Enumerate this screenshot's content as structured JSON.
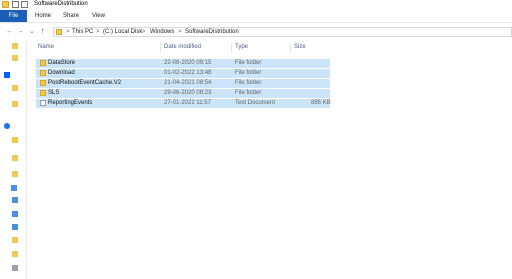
{
  "window": {
    "title": "SoftwareDistribution"
  },
  "ribbon": {
    "file_label": "File",
    "tabs": [
      "Home",
      "Share",
      "View"
    ]
  },
  "address": {
    "crumbs": [
      "This PC",
      "(C:) Local Disk",
      "Windows",
      "SoftwareDistribution"
    ],
    "separator": ">"
  },
  "nav": {
    "back": "←",
    "forward": "→",
    "recent": "⌄",
    "up": "↑"
  },
  "columns": {
    "name": "Name",
    "date": "Date modified",
    "type": "Type",
    "size": "Size"
  },
  "files": [
    {
      "name": "DataStore",
      "date": "22-06-2020 09:15",
      "type": "File folder",
      "size": "",
      "icon": "folder-icon"
    },
    {
      "name": "Download",
      "date": "01-02-2022 13:48",
      "type": "File folder",
      "size": "",
      "icon": "folder-icon"
    },
    {
      "name": "PostRebootEventCache.V2",
      "date": "21-04-2021 08:54",
      "type": "File folder",
      "size": "",
      "icon": "folder-icon"
    },
    {
      "name": "SLS",
      "date": "29-06-2020 08:23",
      "type": "File folder",
      "size": "",
      "icon": "folder-icon"
    },
    {
      "name": "ReportingEvents",
      "date": "27-01-2022 11:57",
      "type": "Text Document",
      "size": "885 KB",
      "icon": "text-document-icon"
    }
  ],
  "colors": {
    "accent": "#1a5fb4",
    "selection": "#cce4f7",
    "folder": "#f2c94c"
  }
}
